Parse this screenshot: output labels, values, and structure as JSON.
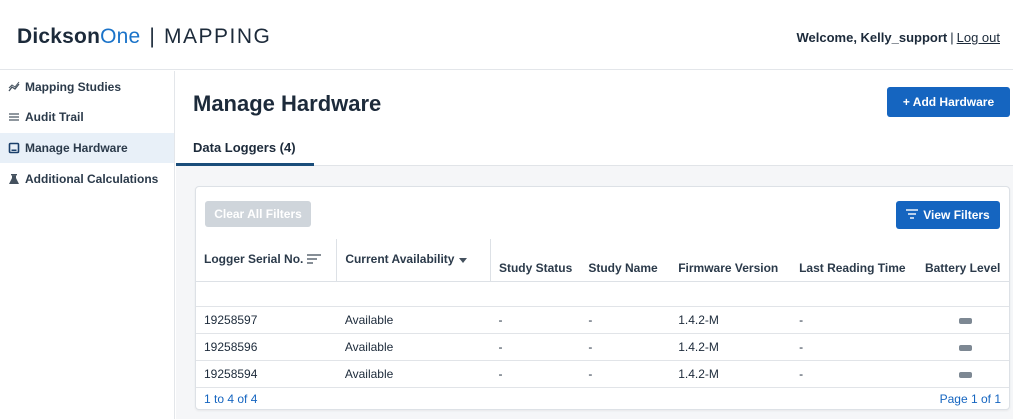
{
  "brand": {
    "part1": "Dickson",
    "part2": "One",
    "separator": "|",
    "module": "MAPPING"
  },
  "user": {
    "welcome": "Welcome, Kelly_support",
    "separator": "|",
    "logout": "Log out"
  },
  "sidebar": {
    "items": [
      {
        "label": "Mapping Studies",
        "icon": "trend-line-icon"
      },
      {
        "label": "Audit Trail",
        "icon": "list-icon"
      },
      {
        "label": "Manage Hardware",
        "icon": "device-icon",
        "active": true
      },
      {
        "label": "Additional Calculations",
        "icon": "flask-icon"
      }
    ]
  },
  "main": {
    "title": "Manage Hardware",
    "add_button": "+ Add Hardware",
    "tab": "Data Loggers (4)"
  },
  "filters": {
    "clear_label": "Clear All Filters",
    "view_label": "View Filters"
  },
  "table": {
    "columns": [
      "Logger Serial No.",
      "Current Availability",
      "Study Status",
      "Study Name",
      "Firmware Version",
      "Last Reading Time",
      "Battery Level"
    ],
    "rows": [
      {
        "serial": "19258597",
        "availability": "Available",
        "status": "-",
        "name": "-",
        "firmware": "1.4.2-M",
        "last_reading": "-"
      },
      {
        "serial": "19258596",
        "availability": "Available",
        "status": "-",
        "name": "-",
        "firmware": "1.4.2-M",
        "last_reading": "-"
      },
      {
        "serial": "19258594",
        "availability": "Available",
        "status": "-",
        "name": "-",
        "firmware": "1.4.2-M",
        "last_reading": "-"
      }
    ],
    "range": "1 to 4 of 4",
    "page": "Page 1 of 1"
  },
  "colors": {
    "primary": "#1565c0",
    "brand_accent": "#1a73c9",
    "active_nav": "#e8f0f8",
    "tab_underline": "#1a4d7a",
    "disabled": "#cfd5db"
  }
}
